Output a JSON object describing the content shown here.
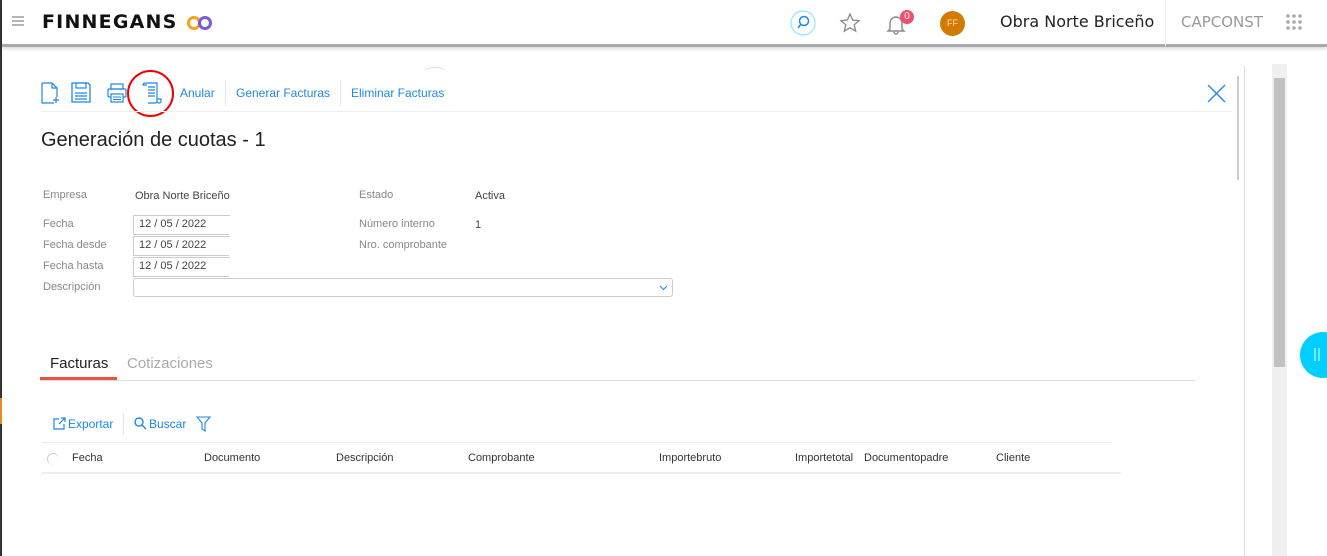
{
  "header": {
    "brand": "FINNEGANS",
    "notifications": "0",
    "avatar_initials": "FF",
    "organization": "Obra Norte Briceño",
    "tenant": "CAPCONST"
  },
  "toolbar": {
    "anular": "Anular",
    "generar": "Generar Facturas",
    "eliminar": "Eliminar Facturas"
  },
  "page": {
    "title": "Generación de cuotas - 1"
  },
  "form": {
    "empresa_label": "Empresa",
    "empresa_value": "Obra Norte Briceño",
    "estado_label": "Estado",
    "estado_value": "Activa",
    "fecha_label": "Fecha",
    "fecha_value": "12 / 05 /  2022",
    "fecha_desde_label": "Fecha desde",
    "fecha_desde_value": "12 / 05 /  2022",
    "fecha_hasta_label": "Fecha hasta",
    "fecha_hasta_value": "12 / 05 /  2022",
    "numero_interno_label": "Número interno",
    "numero_interno_value": "1",
    "nro_comprobante_label": "Nro. comprobante",
    "descripcion_label": "Descripción",
    "descripcion_value": ""
  },
  "tabs": [
    {
      "label": "Facturas",
      "active": true
    },
    {
      "label": "Cotizaciones",
      "active": false
    }
  ],
  "grid": {
    "exportar": "Exportar",
    "buscar": "Buscar",
    "columns": [
      "Fecha",
      "Documento",
      "Descripción",
      "Comprobante",
      "Importebruto",
      "Importetotal",
      "Documentopadre",
      "Cliente"
    ]
  },
  "colors": {
    "accent": "#1e88e5",
    "tab_active": "#e8543f",
    "avatar": "#d27b00",
    "side_button": "#00cfff"
  }
}
